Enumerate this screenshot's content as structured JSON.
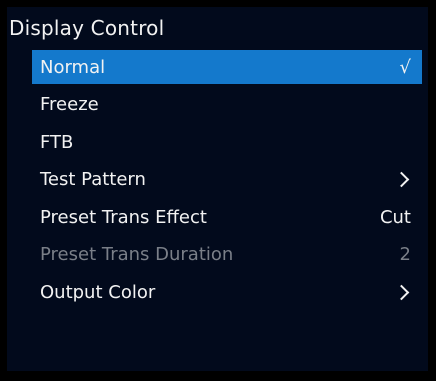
{
  "menu": {
    "title": "Display Control",
    "items": [
      {
        "label": "Normal",
        "value": "√"
      },
      {
        "label": "Freeze"
      },
      {
        "label": "FTB"
      },
      {
        "label": "Test Pattern",
        "icon": "chevron-right-icon"
      },
      {
        "label": "Preset Trans Effect",
        "value": "Cut"
      },
      {
        "label": "Preset Trans Duration",
        "value": "2"
      },
      {
        "label": "Output Color",
        "icon": "chevron-right-icon"
      }
    ]
  },
  "colors": {
    "background": "#020a1c",
    "highlight": "#1479cc",
    "text": "#f2f2f2",
    "disabled_text": "#7a7f88"
  }
}
